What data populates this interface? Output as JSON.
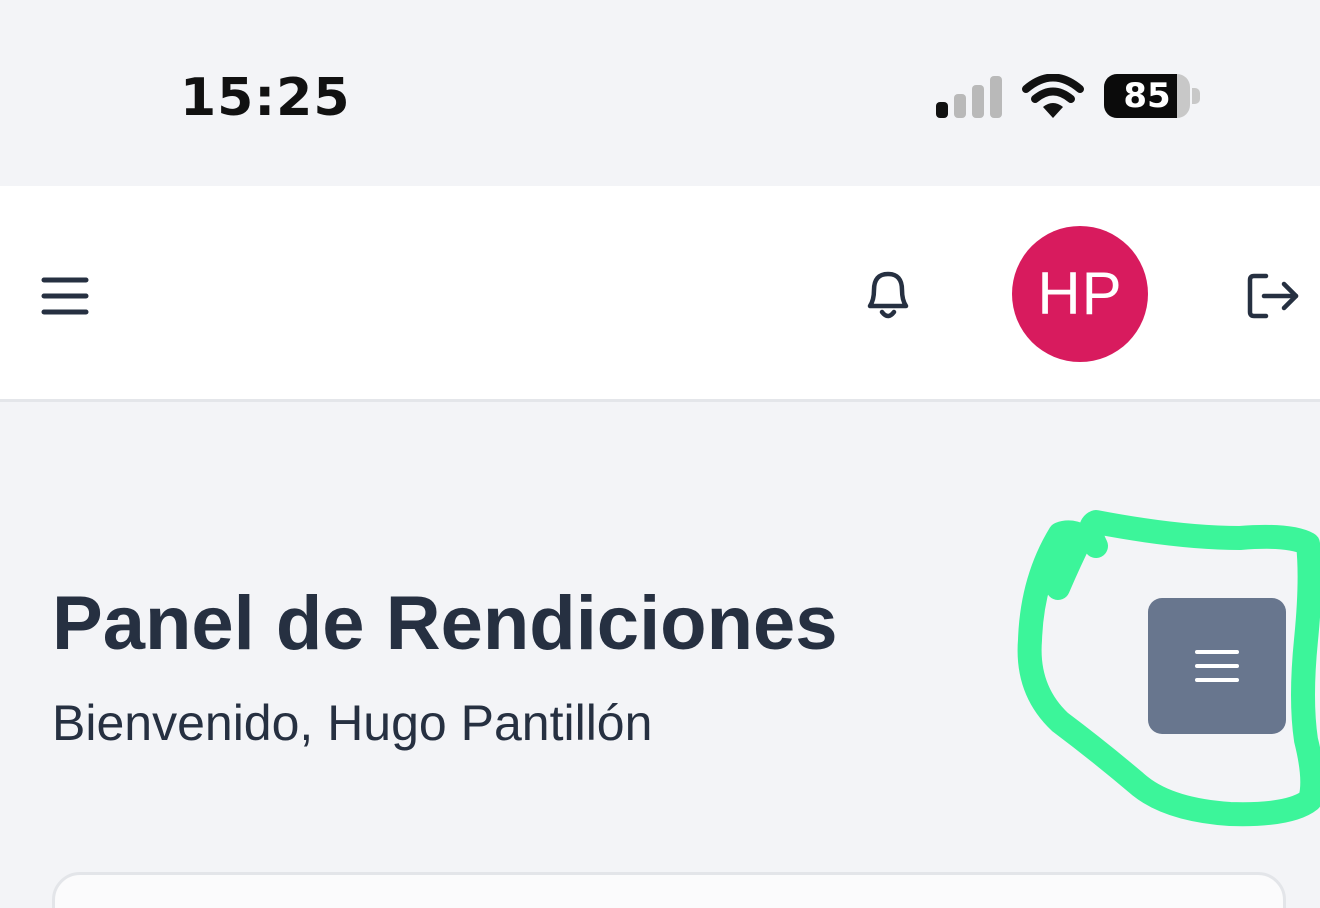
{
  "status_bar": {
    "time": "15:25",
    "battery_level": "85",
    "battery_fraction": 0.85,
    "icons": [
      "signal-icon",
      "wifi-icon",
      "battery-icon"
    ]
  },
  "header": {
    "menu_icon": "menu-icon",
    "notifications_icon": "bell-icon",
    "avatar_initials": "HP",
    "avatar_color": "#d81b5e",
    "logout_icon": "logout-icon"
  },
  "main": {
    "title": "Panel de Rendiciones",
    "subtitle": "Bienvenido, Hugo Pantillón",
    "options_icon": "menu-icon",
    "options_button_color": "#68768e",
    "annotation_color": "#3cf59a"
  },
  "colors": {
    "background": "#f3f4f7",
    "header_background": "#ffffff",
    "text": "#263041"
  }
}
